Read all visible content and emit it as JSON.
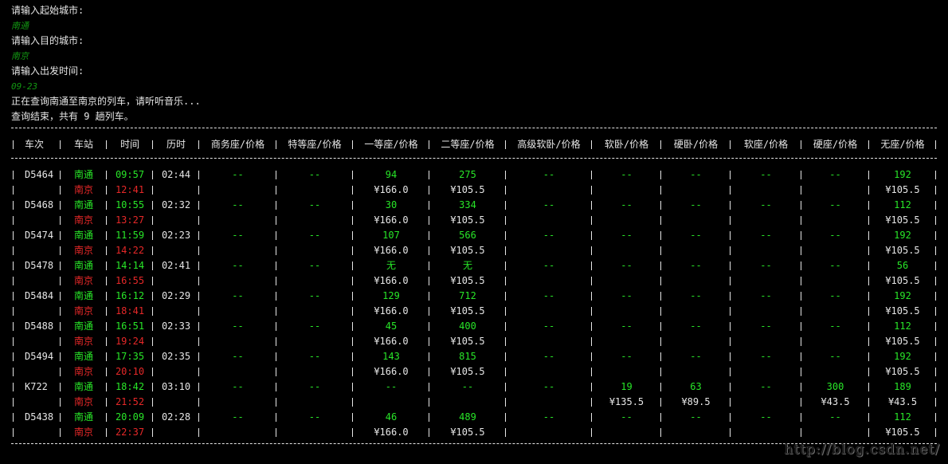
{
  "prompts": {
    "origin_label": "请输入起始城市:",
    "origin_value": "南通",
    "dest_label": "请输入目的城市:",
    "dest_value": "南京",
    "date_label": "请输入出发时间:",
    "date_value": "09-23",
    "querying": "正在查询南通至南京的列车，请听听音乐...",
    "done": "查询结束，共有 9 趟列车。"
  },
  "table": {
    "headers": [
      "车次",
      "车站",
      "时间",
      "历时",
      "商务座/价格",
      "特等座/价格",
      "一等座/价格",
      "二等座/价格",
      "高级软卧/价格",
      "软卧/价格",
      "硬卧/价格",
      "软座/价格",
      "硬座/价格",
      "无座/价格"
    ],
    "trains": [
      {
        "no": "D5464",
        "from": "南通",
        "to": "南京",
        "dep": "09:57",
        "arr": "12:41",
        "dur": "02:44",
        "biz": "--",
        "special": "--",
        "first": "94",
        "first_price": "¥166.0",
        "second": "275",
        "second_price": "¥105.5",
        "adv_soft_sleeper": "--",
        "soft_sleeper": "--",
        "soft_sleeper_price": "",
        "hard_sleeper": "--",
        "hard_sleeper_price": "",
        "soft_seat": "--",
        "hard_seat": "--",
        "hard_seat_price": "",
        "no_seat": "192",
        "no_seat_price": "¥105.5"
      },
      {
        "no": "D5468",
        "from": "南通",
        "to": "南京",
        "dep": "10:55",
        "arr": "13:27",
        "dur": "02:32",
        "biz": "--",
        "special": "--",
        "first": "30",
        "first_price": "¥166.0",
        "second": "334",
        "second_price": "¥105.5",
        "adv_soft_sleeper": "--",
        "soft_sleeper": "--",
        "soft_sleeper_price": "",
        "hard_sleeper": "--",
        "hard_sleeper_price": "",
        "soft_seat": "--",
        "hard_seat": "--",
        "hard_seat_price": "",
        "no_seat": "112",
        "no_seat_price": "¥105.5"
      },
      {
        "no": "D5474",
        "from": "南通",
        "to": "南京",
        "dep": "11:59",
        "arr": "14:22",
        "dur": "02:23",
        "biz": "--",
        "special": "--",
        "first": "107",
        "first_price": "¥166.0",
        "second": "566",
        "second_price": "¥105.5",
        "adv_soft_sleeper": "--",
        "soft_sleeper": "--",
        "soft_sleeper_price": "",
        "hard_sleeper": "--",
        "hard_sleeper_price": "",
        "soft_seat": "--",
        "hard_seat": "--",
        "hard_seat_price": "",
        "no_seat": "192",
        "no_seat_price": "¥105.5"
      },
      {
        "no": "D5478",
        "from": "南通",
        "to": "南京",
        "dep": "14:14",
        "arr": "16:55",
        "dur": "02:41",
        "biz": "--",
        "special": "--",
        "first": "无",
        "first_price": "¥166.0",
        "second": "无",
        "second_price": "¥105.5",
        "adv_soft_sleeper": "--",
        "soft_sleeper": "--",
        "soft_sleeper_price": "",
        "hard_sleeper": "--",
        "hard_sleeper_price": "",
        "soft_seat": "--",
        "hard_seat": "--",
        "hard_seat_price": "",
        "no_seat": "56",
        "no_seat_price": "¥105.5"
      },
      {
        "no": "D5484",
        "from": "南通",
        "to": "南京",
        "dep": "16:12",
        "arr": "18:41",
        "dur": "02:29",
        "biz": "--",
        "special": "--",
        "first": "129",
        "first_price": "¥166.0",
        "second": "712",
        "second_price": "¥105.5",
        "adv_soft_sleeper": "--",
        "soft_sleeper": "--",
        "soft_sleeper_price": "",
        "hard_sleeper": "--",
        "hard_sleeper_price": "",
        "soft_seat": "--",
        "hard_seat": "--",
        "hard_seat_price": "",
        "no_seat": "192",
        "no_seat_price": "¥105.5"
      },
      {
        "no": "D5488",
        "from": "南通",
        "to": "南京",
        "dep": "16:51",
        "arr": "19:24",
        "dur": "02:33",
        "biz": "--",
        "special": "--",
        "first": "45",
        "first_price": "¥166.0",
        "second": "400",
        "second_price": "¥105.5",
        "adv_soft_sleeper": "--",
        "soft_sleeper": "--",
        "soft_sleeper_price": "",
        "hard_sleeper": "--",
        "hard_sleeper_price": "",
        "soft_seat": "--",
        "hard_seat": "--",
        "hard_seat_price": "",
        "no_seat": "112",
        "no_seat_price": "¥105.5"
      },
      {
        "no": "D5494",
        "from": "南通",
        "to": "南京",
        "dep": "17:35",
        "arr": "20:10",
        "dur": "02:35",
        "biz": "--",
        "special": "--",
        "first": "143",
        "first_price": "¥166.0",
        "second": "815",
        "second_price": "¥105.5",
        "adv_soft_sleeper": "--",
        "soft_sleeper": "--",
        "soft_sleeper_price": "",
        "hard_sleeper": "--",
        "hard_sleeper_price": "",
        "soft_seat": "--",
        "hard_seat": "--",
        "hard_seat_price": "",
        "no_seat": "192",
        "no_seat_price": "¥105.5"
      },
      {
        "no": "K722",
        "from": "南通",
        "to": "南京",
        "dep": "18:42",
        "arr": "21:52",
        "dur": "03:10",
        "biz": "--",
        "special": "--",
        "first": "--",
        "first_price": "",
        "second": "--",
        "second_price": "",
        "adv_soft_sleeper": "--",
        "soft_sleeper": "19",
        "soft_sleeper_price": "¥135.5",
        "hard_sleeper": "63",
        "hard_sleeper_price": "¥89.5",
        "soft_seat": "--",
        "hard_seat": "300",
        "hard_seat_price": "¥43.5",
        "no_seat": "189",
        "no_seat_price": "¥43.5"
      },
      {
        "no": "D5438",
        "from": "南通",
        "to": "南京",
        "dep": "20:09",
        "arr": "22:37",
        "dur": "02:28",
        "biz": "--",
        "special": "--",
        "first": "46",
        "first_price": "¥166.0",
        "second": "489",
        "second_price": "¥105.5",
        "adv_soft_sleeper": "--",
        "soft_sleeper": "--",
        "soft_sleeper_price": "",
        "hard_sleeper": "--",
        "hard_sleeper_price": "",
        "soft_seat": "--",
        "hard_seat": "--",
        "hard_seat_price": "",
        "no_seat": "112",
        "no_seat_price": "¥105.5"
      }
    ]
  },
  "watermark": "http://blog.csdn.net/",
  "colors": {
    "background": "#000000",
    "text": "#e6e6e6",
    "seat_green": "#28e628",
    "arrival_red": "#e62828",
    "input_green": "#129612"
  }
}
